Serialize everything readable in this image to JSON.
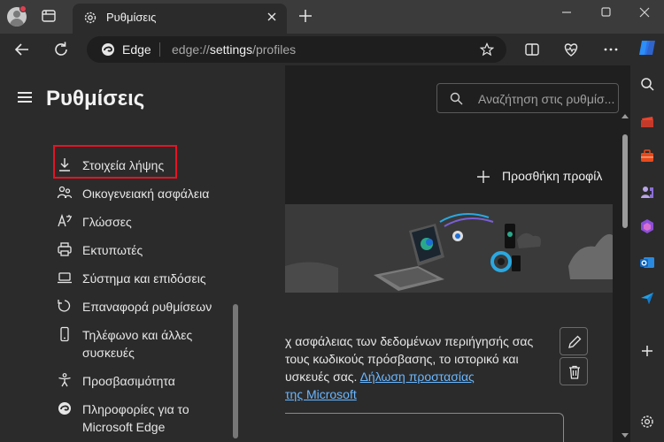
{
  "window": {
    "tab_title": "Ρυθμίσεις"
  },
  "address_bar": {
    "site_name": "Edge",
    "url_prefix": "edge://",
    "url_host": "settings",
    "url_path": "/profiles"
  },
  "sidebar": {
    "title": "Ρυθμίσεις",
    "items": [
      {
        "label": "Στοιχεία λήψης",
        "icon": "download-icon"
      },
      {
        "label": "Οικογενειακή ασφάλεια",
        "icon": "family-icon"
      },
      {
        "label": "Γλώσσες",
        "icon": "language-icon"
      },
      {
        "label": "Εκτυπωτές",
        "icon": "printer-icon"
      },
      {
        "label": "Σύστημα και επιδόσεις",
        "icon": "laptop-icon"
      },
      {
        "label": "Επαναφορά ρυθμίσεων",
        "icon": "reset-icon"
      },
      {
        "label": "Τηλέφωνο και άλλες",
        "label2": "συσκευές",
        "icon": "phone-icon"
      },
      {
        "label": "Προσβασιμότητα",
        "icon": "accessibility-icon"
      },
      {
        "label": "Πληροφορίες για το",
        "label2": "Microsoft Edge",
        "icon": "edge-icon"
      }
    ]
  },
  "search": {
    "placeholder": "Αναζήτηση στις ρυθμίσ..."
  },
  "main": {
    "add_profile_label": "Προσθήκη προφίλ",
    "text_line1": "χ ασφάλειας των δεδομένων περιήγησής σας",
    "text_line2": "τους κωδικούς πρόσβασης, το ιστορικό και",
    "text_line3_pre": "υσκευές σας. ",
    "text_line3_link": "Δήλωση προστασίας",
    "text_line4_link": "της Microsoft"
  },
  "colors": {
    "highlight": "#e81224",
    "link": "#6ab7ff",
    "accent": "#0078d4"
  }
}
